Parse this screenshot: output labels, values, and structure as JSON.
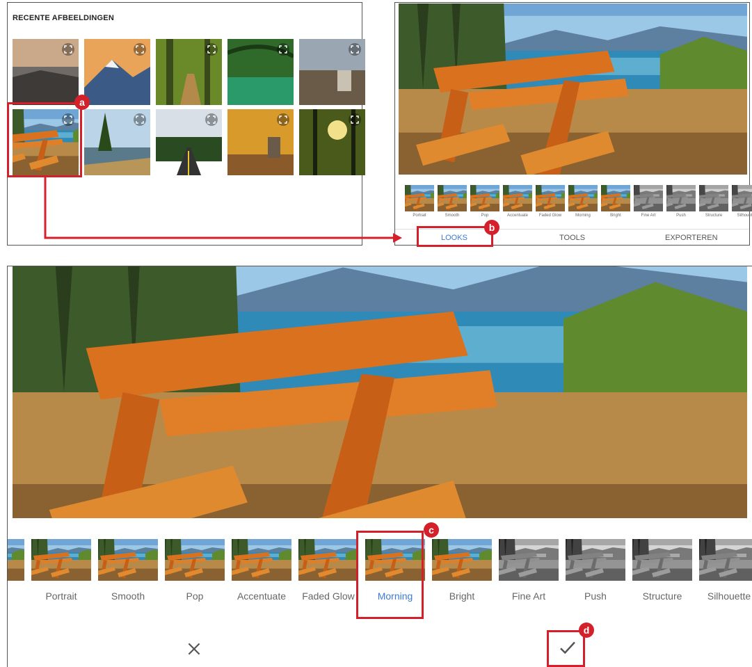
{
  "recent_panel": {
    "title": "RECENTE AFBEELDINGEN"
  },
  "tabs": {
    "looks": "LOOKS",
    "tools": "TOOLS",
    "export": "EXPORTEREN"
  },
  "small_filters": [
    "Portrait",
    "Smooth",
    "Pop",
    "Accentuate",
    "Faded Glow",
    "Morning",
    "Bright",
    "Fine Art",
    "Push",
    "Structure",
    "Silhouette"
  ],
  "big_filters": [
    "Portrait",
    "Smooth",
    "Pop",
    "Accentuate",
    "Faded Glow",
    "Morning",
    "Bright",
    "Fine Art",
    "Push",
    "Structure",
    "Silhouette"
  ],
  "selected_filter": "Morning",
  "callouts": {
    "a": "a",
    "b": "b",
    "c": "c",
    "d": "d"
  },
  "colors": {
    "accent": "#3b7bd4",
    "highlight": "#d4202a"
  },
  "icons": {
    "cancel": "close-icon",
    "confirm": "checkmark-icon",
    "expand": "expand-icon"
  }
}
